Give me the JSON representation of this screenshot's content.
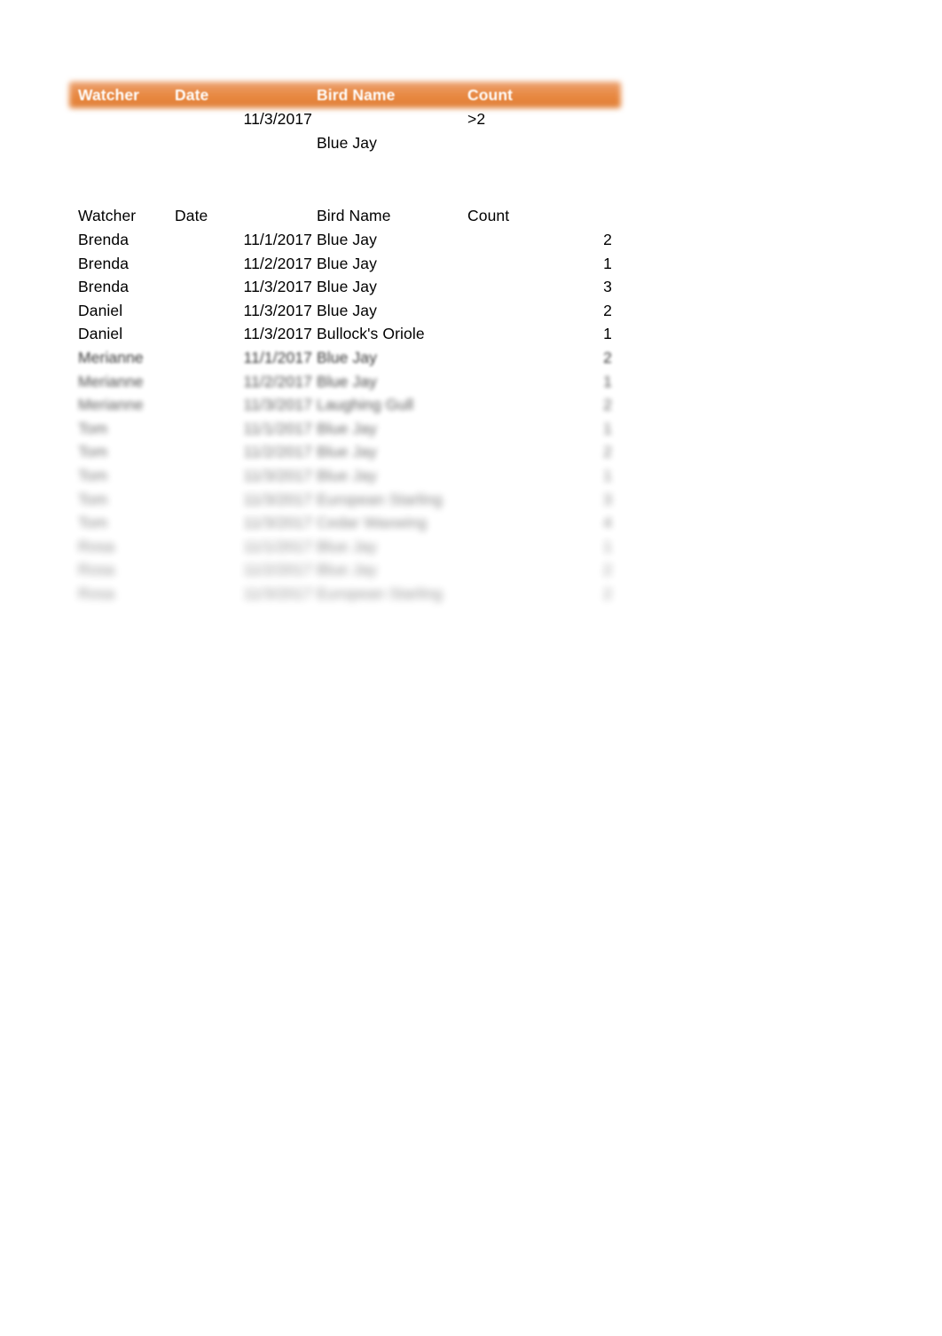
{
  "criteria": {
    "headers": {
      "watcher": "Watcher",
      "date": "Date",
      "bird_name": "Bird Name",
      "count": "Count"
    },
    "header_bar_color": "#e8873f",
    "header_text_color": "#ffffff",
    "rows": [
      {
        "watcher": "",
        "date": "11/3/2017",
        "bird_name": "",
        "count": ">2"
      },
      {
        "watcher": "",
        "date": "",
        "bird_name": "Blue Jay",
        "count": ""
      }
    ]
  },
  "data_table": {
    "headers": {
      "watcher": "Watcher",
      "date": "Date",
      "bird_name": "Bird Name",
      "count": "Count"
    },
    "rows": [
      {
        "watcher": "Brenda",
        "date": "11/1/2017",
        "bird_name": "Blue Jay",
        "count": "2"
      },
      {
        "watcher": "Brenda",
        "date": "11/2/2017",
        "bird_name": "Blue Jay",
        "count": "1"
      },
      {
        "watcher": "Brenda",
        "date": "11/3/2017",
        "bird_name": "Blue Jay",
        "count": "3"
      },
      {
        "watcher": "Daniel",
        "date": "11/3/2017",
        "bird_name": "Blue Jay",
        "count": "2"
      },
      {
        "watcher": "Daniel",
        "date": "11/3/2017",
        "bird_name": "Bullock's Oriole",
        "count": "1"
      },
      {
        "watcher": "Merianne",
        "date": "11/1/2017",
        "bird_name": "Blue Jay",
        "count": "2"
      },
      {
        "watcher": "Merianne",
        "date": "11/2/2017",
        "bird_name": "Blue Jay",
        "count": "1"
      },
      {
        "watcher": "Merianne",
        "date": "11/3/2017",
        "bird_name": "Laughing Gull",
        "count": "2"
      },
      {
        "watcher": "Tom",
        "date": "11/1/2017",
        "bird_name": "Blue Jay",
        "count": "1"
      },
      {
        "watcher": "Tom",
        "date": "11/2/2017",
        "bird_name": "Blue Jay",
        "count": "2"
      },
      {
        "watcher": "Tom",
        "date": "11/3/2017",
        "bird_name": "Blue Jay",
        "count": "1"
      },
      {
        "watcher": "Tom",
        "date": "11/3/2017",
        "bird_name": "European Starling",
        "count": "3"
      },
      {
        "watcher": "Tom",
        "date": "11/3/2017",
        "bird_name": "Cedar Waxwing",
        "count": "4"
      },
      {
        "watcher": "Rosa",
        "date": "11/1/2017",
        "bird_name": "Blue Jay",
        "count": "1"
      },
      {
        "watcher": "Rosa",
        "date": "11/2/2017",
        "bird_name": "Blue Jay",
        "count": "2"
      },
      {
        "watcher": "Rosa",
        "date": "11/3/2017",
        "bird_name": "European Starling",
        "count": "2"
      }
    ]
  }
}
